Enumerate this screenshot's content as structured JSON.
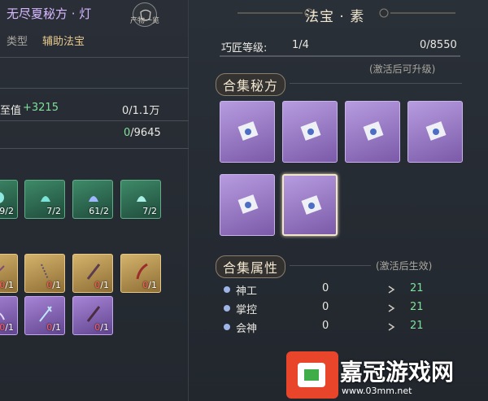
{
  "left_panel": {
    "title": "无尽夏秘方 · 灯",
    "badge_label": "产物一览",
    "type_label": "类型",
    "type_value": "辅助法宝",
    "stat_label_partial": "至值",
    "stat_bonus": "+3215",
    "stat_progress": "0/1.1万",
    "stat2_current": "0",
    "stat2_total": "/9645",
    "green_tiles": [
      {
        "count": "9/2",
        "icon": "teal-swirl-icon"
      },
      {
        "count": "7/2",
        "icon": "green-bell-icon"
      },
      {
        "count": "61/2",
        "icon": "blue-bell-icon"
      },
      {
        "count": "7/2",
        "icon": "cyan-bell-icon"
      }
    ],
    "gold_tiles": [
      {
        "count_red": "0",
        "count_rest": "/1",
        "icon": "chain-icon"
      },
      {
        "count_red": "0",
        "count_rest": "/1",
        "icon": "chain-icon"
      },
      {
        "count_red": "0",
        "count_rest": "/1",
        "icon": "rod-icon"
      },
      {
        "count_red": "0",
        "count_rest": "/1",
        "icon": "hook-icon"
      }
    ],
    "purple_tiles": [
      {
        "count_red": "0",
        "count_rest": "/1",
        "icon": "arc-icon"
      },
      {
        "count_red": "0",
        "count_rest": "/1",
        "icon": "fork-icon"
      },
      {
        "count_red": "0",
        "count_rest": "/1",
        "icon": "brush-icon"
      }
    ]
  },
  "right_panel": {
    "title": "法宝 · 素",
    "craft_level_label": "巧匠等级:",
    "craft_level_value": "1/4",
    "craft_exp": "0/8550",
    "craft_note": "(激活后可升级)",
    "recipe_section_title": "合集秘方",
    "recipes": [
      {
        "icon": "scroll-icon",
        "selected": false
      },
      {
        "icon": "scroll-icon",
        "selected": false
      },
      {
        "icon": "scroll-icon",
        "selected": false
      },
      {
        "icon": "scroll-icon",
        "selected": false
      },
      {
        "icon": "scroll-icon",
        "selected": false
      },
      {
        "icon": "scroll-icon",
        "selected": true
      }
    ],
    "attr_section_title": "合集属性",
    "attr_note": "(激活后生效)",
    "attributes": [
      {
        "name": "神工",
        "current": "0",
        "next": "21"
      },
      {
        "name": "掌控",
        "current": "0",
        "next": "21"
      },
      {
        "name": "会神",
        "current": "0",
        "next": "21"
      }
    ]
  },
  "watermark": {
    "brand": "嘉冠游戏网",
    "url": "www.03mm.net"
  },
  "colors": {
    "accent_green": "#7fe19a",
    "accent_gold": "#e8c98f",
    "title_purple": "#d7b8ff"
  }
}
